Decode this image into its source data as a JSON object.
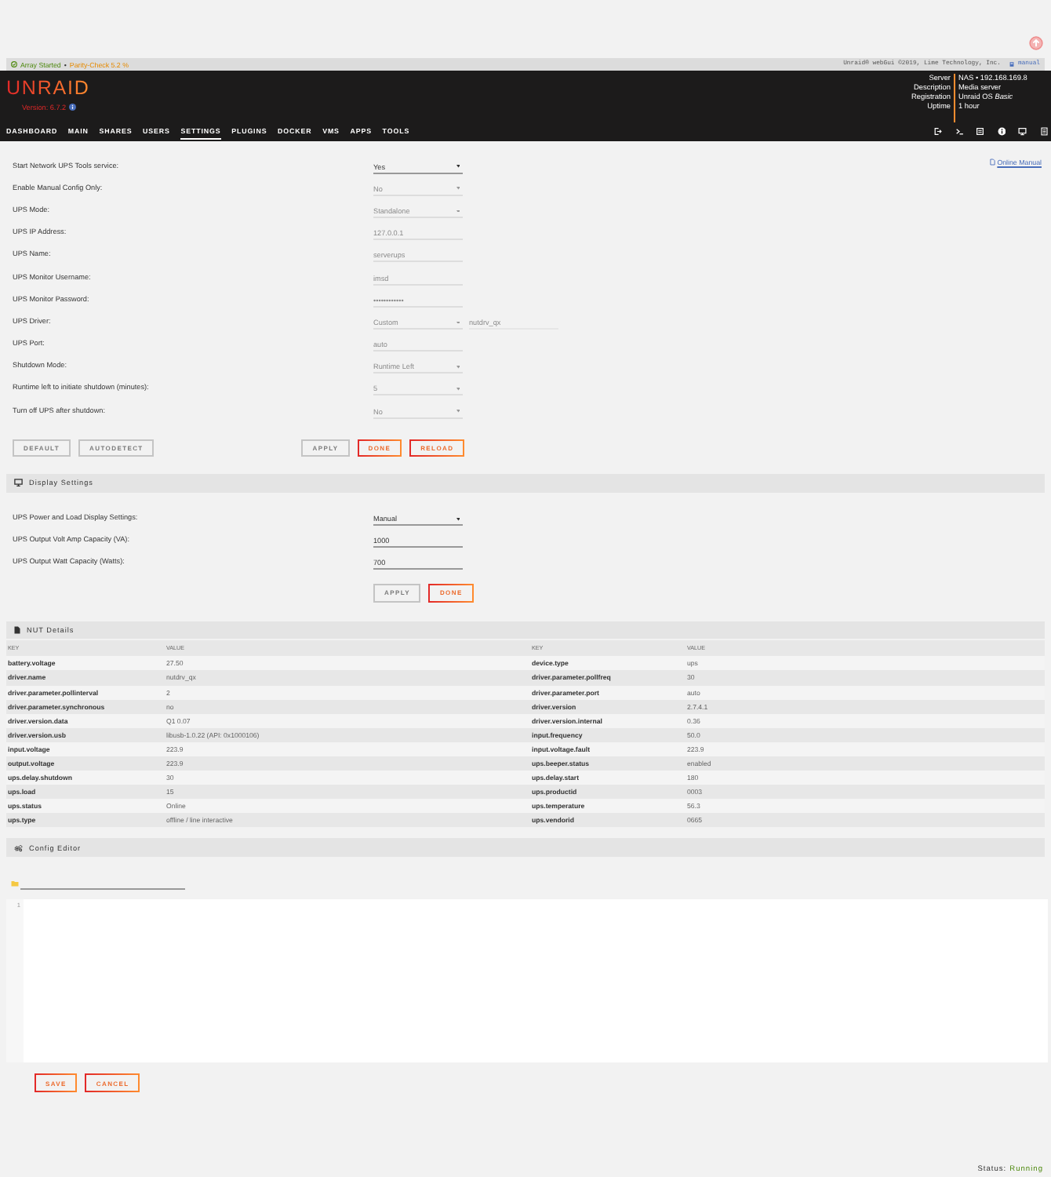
{
  "status_bar": {
    "array_status": "Array Started",
    "separator": "•",
    "parity_check": "Parity-Check 5.2 %",
    "copyright": "Unraid® webGui ©2019, Lime Technology, Inc.",
    "manual_link": "manual"
  },
  "header": {
    "logo": "UNRAID",
    "version": "Version: 6.7.2",
    "server_info": [
      {
        "label": "Server",
        "value": "NAS • 192.168.169.8"
      },
      {
        "label": "Description",
        "value": "Media server"
      },
      {
        "label": "Registration",
        "value": "Unraid OS *Basic*"
      },
      {
        "label": "Uptime",
        "value": "1 hour"
      }
    ]
  },
  "nav": [
    {
      "label": "DASHBOARD",
      "selected": false
    },
    {
      "label": "MAIN",
      "selected": false
    },
    {
      "label": "SHARES",
      "selected": false
    },
    {
      "label": "USERS",
      "selected": false
    },
    {
      "label": "SETTINGS",
      "selected": true
    },
    {
      "label": "PLUGINS",
      "selected": false
    },
    {
      "label": "DOCKER",
      "selected": false
    },
    {
      "label": "VMS",
      "selected": false
    },
    {
      "label": "APPS",
      "selected": false
    },
    {
      "label": "TOOLS",
      "selected": false
    }
  ],
  "ups_settings": {
    "online_manual": "Online Manual",
    "rows": [
      {
        "label": "Start Network UPS Tools service:",
        "fields": [
          {
            "kind": "select",
            "value": "Yes",
            "disabled": false
          }
        ]
      },
      {
        "label": "Enable Manual Config Only:",
        "fields": [
          {
            "kind": "select",
            "value": "No",
            "disabled": true
          }
        ]
      },
      {
        "label": "UPS Mode:",
        "fields": [
          {
            "kind": "select",
            "value": "Standalone",
            "disabled": true
          }
        ]
      },
      {
        "label": "UPS IP Address:",
        "fields": [
          {
            "kind": "text",
            "value": "127.0.0.1",
            "disabled": true
          }
        ]
      },
      {
        "label": "UPS Name:",
        "fields": [
          {
            "kind": "text",
            "value": "serverups",
            "disabled": true
          }
        ]
      },
      {
        "label": "UPS Monitor Username:",
        "fields": [
          {
            "kind": "text",
            "value": "imsd",
            "disabled": true
          }
        ]
      },
      {
        "label": "UPS Monitor Password:",
        "fields": [
          {
            "kind": "password",
            "value": "••••••••••••",
            "disabled": true
          }
        ]
      },
      {
        "label": "UPS Driver:",
        "fields": [
          {
            "kind": "select",
            "value": "Custom",
            "disabled": true
          },
          {
            "kind": "text",
            "value": "nutdrv_qx",
            "disabled": true
          }
        ]
      },
      {
        "label": "UPS Port:",
        "fields": [
          {
            "kind": "text",
            "value": "auto",
            "disabled": true
          }
        ]
      },
      {
        "label": "Shutdown Mode:",
        "fields": [
          {
            "kind": "select",
            "value": "Runtime Left",
            "disabled": true
          }
        ]
      },
      {
        "label": "Runtime left to initiate shutdown (minutes):",
        "fields": [
          {
            "kind": "select",
            "value": "5",
            "disabled": true
          }
        ]
      },
      {
        "label": "Turn off UPS after shutdown:",
        "fields": [
          {
            "kind": "select",
            "value": "No",
            "disabled": true
          }
        ]
      }
    ],
    "left_buttons": [
      {
        "label": "DEFAULT",
        "disabled": true
      },
      {
        "label": "AUTODETECT",
        "disabled": true
      }
    ],
    "buttons": [
      {
        "label": "APPLY",
        "disabled": true
      },
      {
        "label": "DONE",
        "disabled": false
      },
      {
        "label": "RELOAD",
        "disabled": false
      }
    ]
  },
  "display_settings": {
    "title": "Display Settings",
    "rows": [
      {
        "label": "UPS Power and Load Display Settings:",
        "fields": [
          {
            "kind": "select",
            "value": "Manual",
            "disabled": false
          }
        ]
      },
      {
        "label": "UPS Output Volt Amp Capacity (VA):",
        "fields": [
          {
            "kind": "text",
            "value": "1000",
            "disabled": false
          }
        ]
      },
      {
        "label": "UPS Output Watt Capacity (Watts):",
        "fields": [
          {
            "kind": "text",
            "value": "700",
            "disabled": false
          }
        ]
      }
    ],
    "buttons": [
      {
        "label": "APPLY",
        "disabled": true
      },
      {
        "label": "DONE",
        "disabled": false
      }
    ]
  },
  "nut_details": {
    "title": "NUT Details",
    "columns": [
      "KEY",
      "VALUE",
      "KEY",
      "VALUE"
    ],
    "rows": [
      [
        "battery.voltage",
        "27.50",
        "device.type",
        "ups"
      ],
      [
        "driver.name",
        "nutdrv_qx",
        "driver.parameter.pollfreq",
        "30"
      ],
      [
        "driver.parameter.pollinterval",
        "2",
        "driver.parameter.port",
        "auto"
      ],
      [
        "driver.parameter.synchronous",
        "no",
        "driver.version",
        "2.7.4.1"
      ],
      [
        "driver.version.data",
        "Q1 0.07",
        "driver.version.internal",
        "0.36"
      ],
      [
        "driver.version.usb",
        "libusb-1.0.22 (API: 0x1000106)",
        "input.frequency",
        "50.0"
      ],
      [
        "input.voltage",
        "223.9",
        "input.voltage.fault",
        "223.9"
      ],
      [
        "output.voltage",
        "223.9",
        "ups.beeper.status",
        "enabled"
      ],
      [
        "ups.delay.shutdown",
        "30",
        "ups.delay.start",
        "180"
      ],
      [
        "ups.load",
        "15",
        "ups.productid",
        "0003"
      ],
      [
        "ups.status",
        "Online",
        "ups.temperature",
        "56.3"
      ],
      [
        "ups.type",
        "offline / line interactive",
        "ups.vendorid",
        "0665"
      ]
    ]
  },
  "config_editor": {
    "title": "Config Editor",
    "line_numbers": [
      "1"
    ],
    "buttons": [
      {
        "label": "SAVE",
        "disabled": false
      },
      {
        "label": "CANCEL",
        "disabled": false
      }
    ]
  },
  "footer": {
    "status_label": "Status:",
    "status_value": "Running"
  }
}
